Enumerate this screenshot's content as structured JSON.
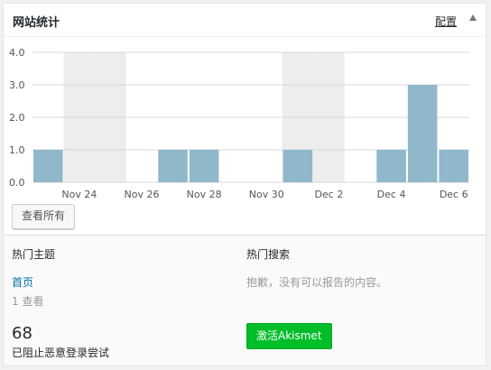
{
  "header": {
    "title": "网站统计",
    "configure": "配置"
  },
  "chart_data": {
    "type": "bar",
    "categories": [
      "Nov 23",
      "Nov 24",
      "Nov 25",
      "Nov 26",
      "Nov 27",
      "Nov 28",
      "Nov 29",
      "Nov 30",
      "Dec 1",
      "Dec 2",
      "Dec 3",
      "Dec 4",
      "Dec 5",
      "Dec 6"
    ],
    "values": [
      1,
      0,
      0,
      0,
      1,
      1,
      0,
      0,
      1,
      0,
      0,
      1,
      3,
      1
    ],
    "weekend_indices": [
      1,
      2,
      8,
      9
    ],
    "x_tick_labels": [
      "Nov 24",
      "Nov 26",
      "Nov 28",
      "Nov 30",
      "Dec 2",
      "Dec 4",
      "Dec 6"
    ],
    "x_tick_indices": [
      1,
      3,
      5,
      7,
      9,
      11,
      13
    ],
    "y_tick_labels": [
      "0.0",
      "1.0",
      "2.0",
      "3.0",
      "4.0"
    ],
    "ylim": [
      0,
      4
    ],
    "bar_color": "#8fb8cb",
    "weekend_color": "#ededed",
    "grid": true
  },
  "view_all": "查看所有",
  "top_posts": {
    "heading": "热门主题",
    "items": [
      {
        "title": "首页",
        "views": "1 查看"
      }
    ]
  },
  "top_searches": {
    "heading": "热门搜索",
    "empty": "抱歉，没有可以报告的内容。"
  },
  "protect": {
    "count": "68",
    "label": "已阻止恶意登录尝试"
  },
  "akismet_button": "激活Akismet"
}
